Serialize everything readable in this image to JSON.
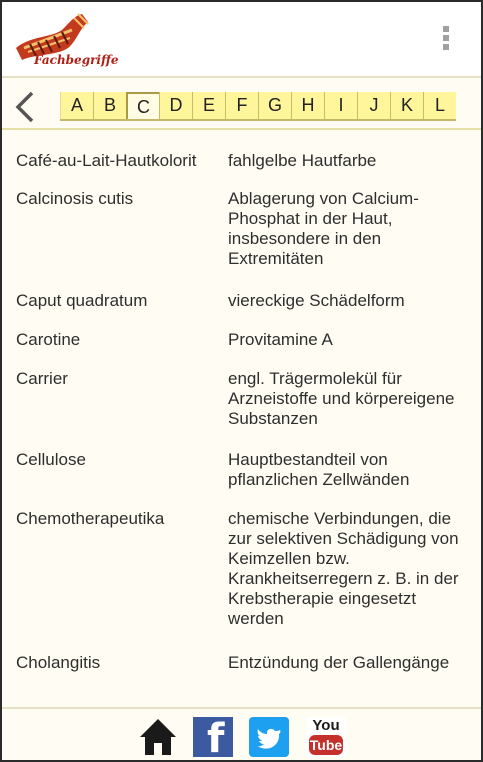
{
  "app": {
    "logo_text": "Fachbegriffe"
  },
  "alphabet": {
    "letters": [
      "A",
      "B",
      "C",
      "D",
      "E",
      "F",
      "G",
      "H",
      "I",
      "J",
      "K",
      "L"
    ],
    "active": "C"
  },
  "entries": [
    {
      "term": "Café-au-Lait-Hautkolorit",
      "definition": "fahlgelbe Hautfarbe"
    },
    {
      "term": "Calcinosis cutis",
      "definition": "Ablagerung von Calcium-Phosphat in der Haut, insbesondere in den Extremitäten"
    },
    {
      "term": "Caput quadratum",
      "definition": "viereckige Schädelform"
    },
    {
      "term": "Carotine",
      "definition": "Provitamine A"
    },
    {
      "term": "Carrier",
      "definition": "engl. Trägermolekül für Arzneistoffe und körpereigene Substanzen"
    },
    {
      "term": "Cellulose",
      "definition": "Hauptbestandteil von pflanzlichen Zellwänden"
    },
    {
      "term": "Chemotherapeutika",
      "definition": "chemische Verbindungen, die zur selektiven Schädigung von Keimzellen bzw. Krankheitserregern z. B. in der Krebstherapie eingesetzt werden"
    },
    {
      "term": "Cholangitis",
      "definition": "Entzündung der Gallengänge"
    }
  ],
  "bottom": {
    "youtube_top": "You",
    "youtube_bottom": "Tube"
  },
  "colors": {
    "tab_yellow": "#fff69c",
    "facebook": "#3b5aa0",
    "twitter": "#1ea0f0",
    "youtube_red": "#c4302b"
  }
}
